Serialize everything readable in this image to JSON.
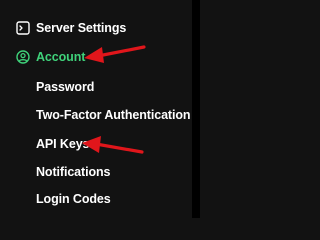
{
  "menu": {
    "server_settings": {
      "label": "Server Settings",
      "icon": "terminal-icon"
    },
    "account": {
      "label": "Account",
      "icon": "user-circle-icon",
      "active": true
    },
    "subitems": [
      {
        "label": "Password"
      },
      {
        "label": "Two-Factor Authentication"
      },
      {
        "label": "API Keys"
      },
      {
        "label": "Notifications"
      },
      {
        "label": "Login Codes"
      }
    ]
  },
  "colors": {
    "background": "#121212",
    "text": "#ffffff",
    "active": "#3fd27a",
    "annotation_arrow": "#e0161b"
  }
}
